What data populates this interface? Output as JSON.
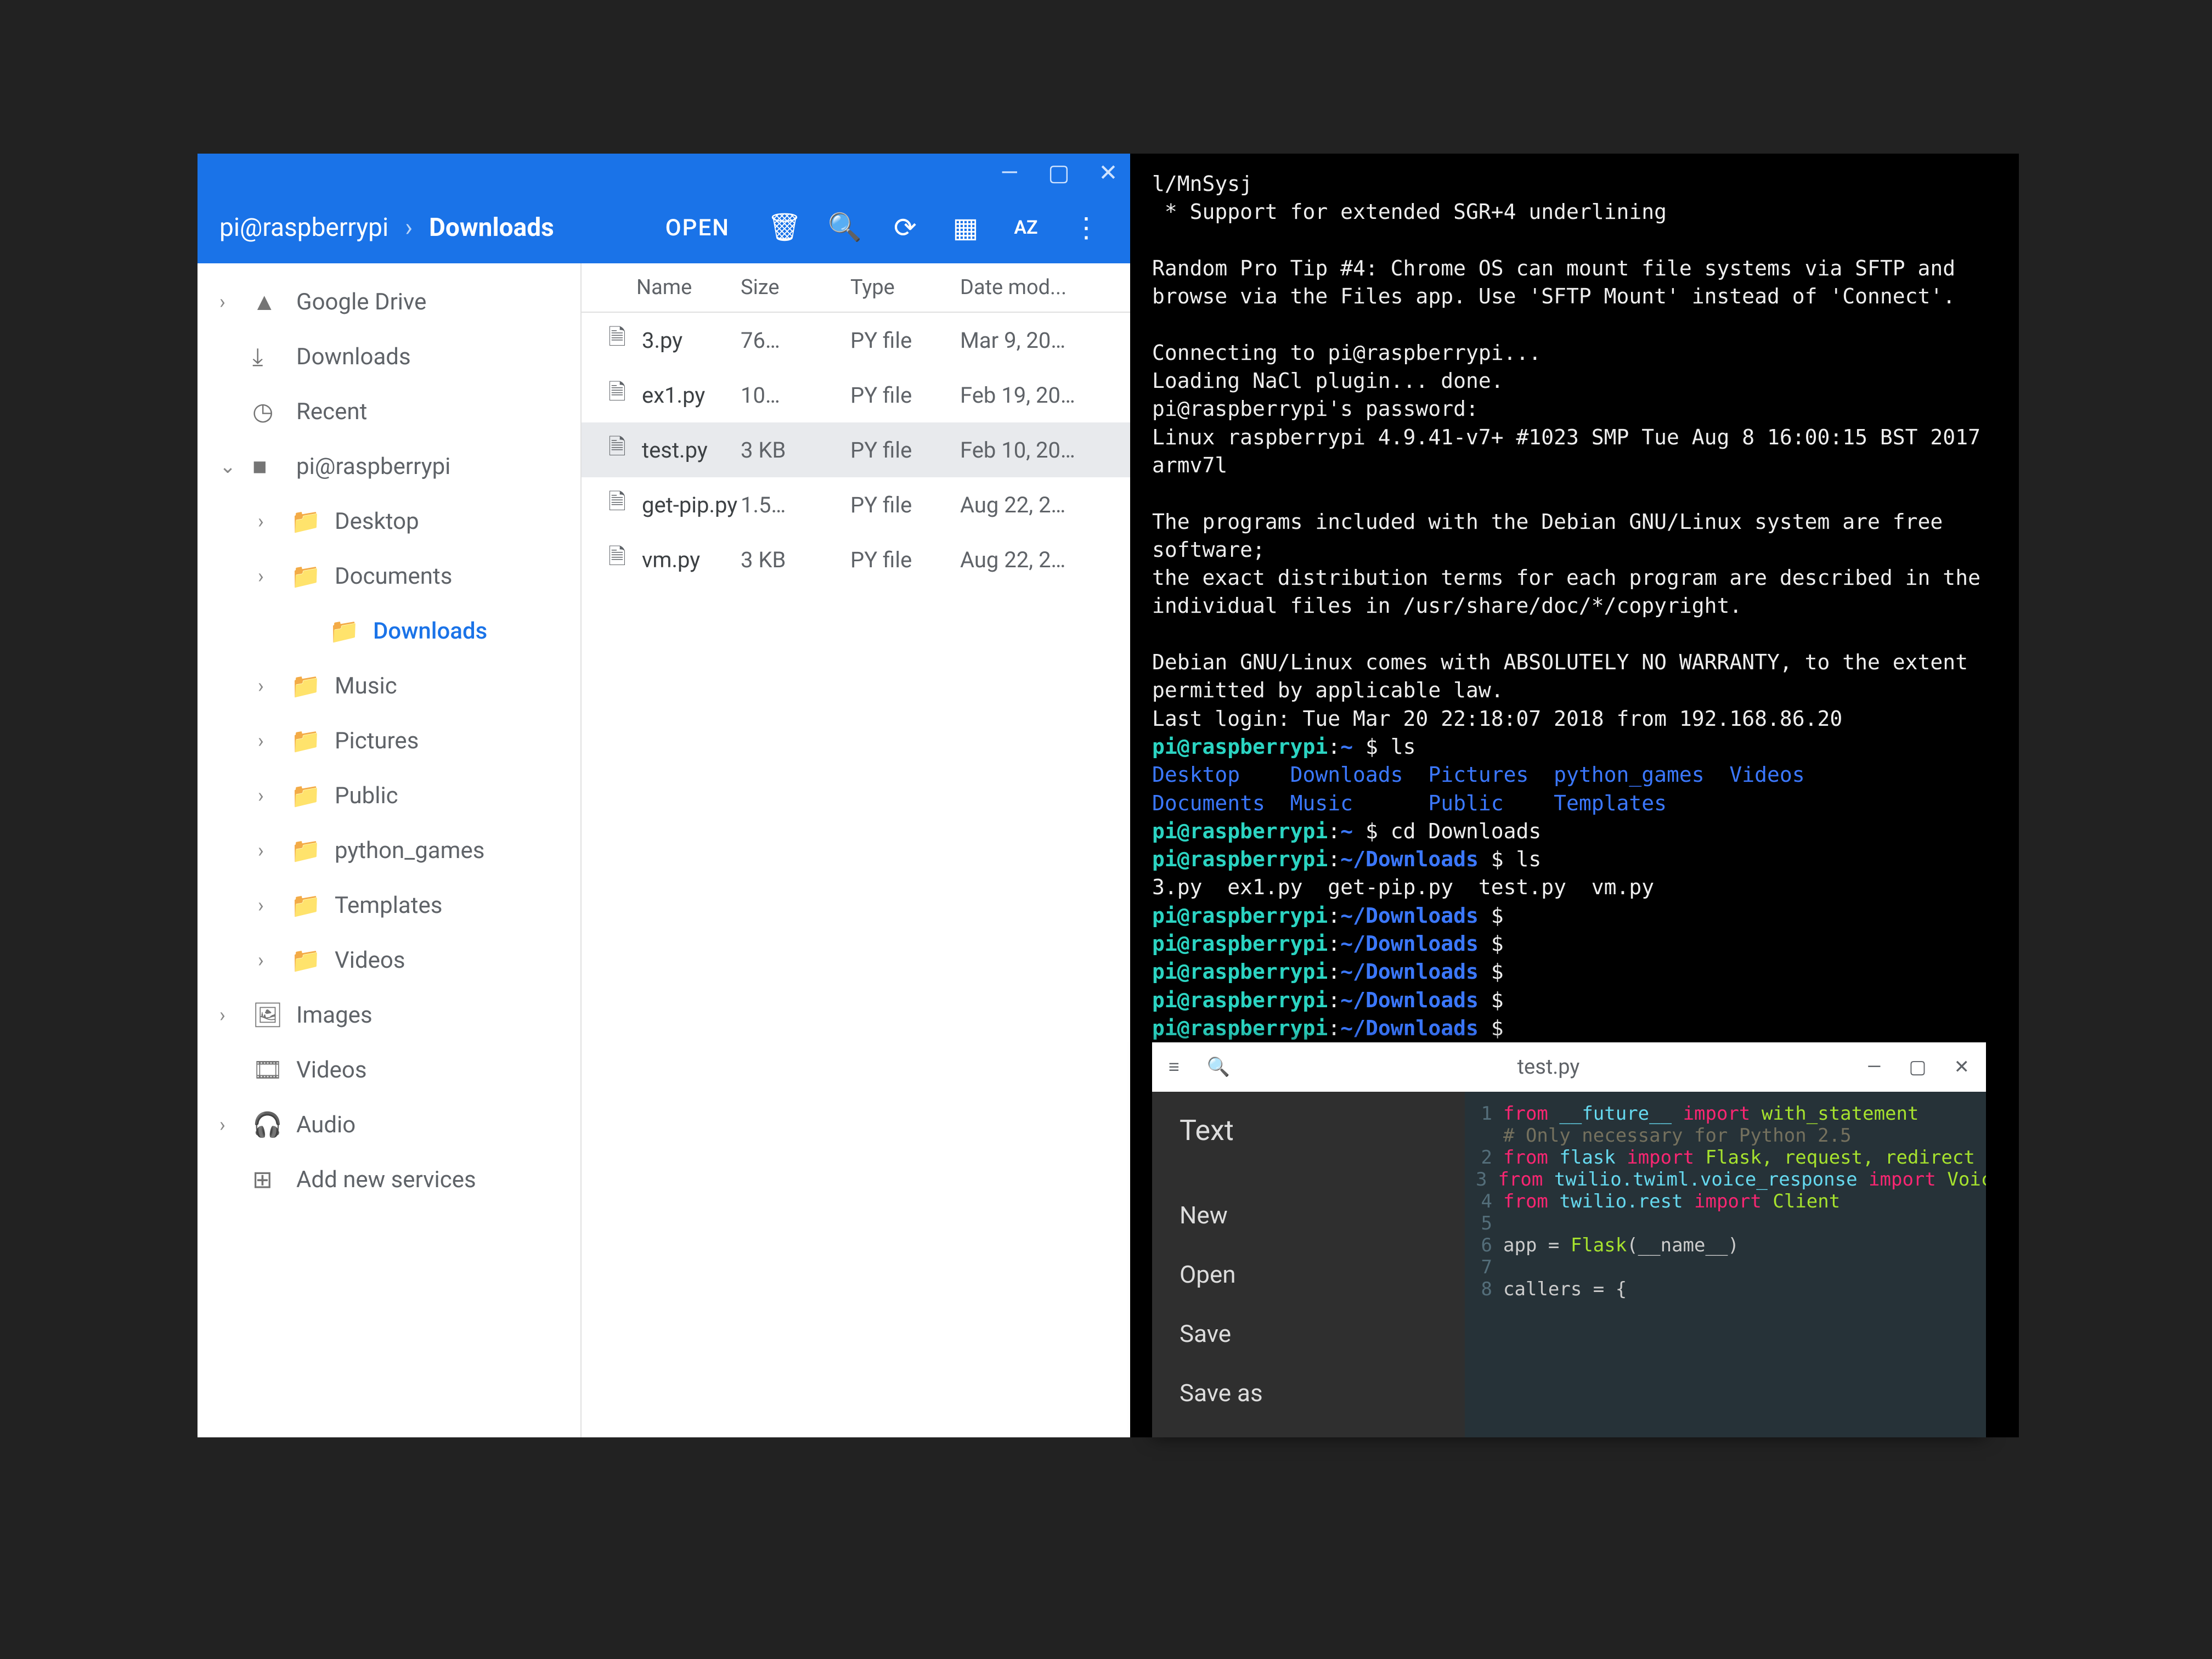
{
  "files": {
    "breadcrumb": [
      "pi@raspberrypi",
      "Downloads"
    ],
    "toolbar": {
      "open": "OPEN",
      "icons": [
        "delete",
        "search",
        "refresh",
        "view",
        "sort",
        "more"
      ]
    },
    "columns": {
      "name": "Name",
      "size": "Size",
      "type": "Type",
      "date": "Date mod..."
    },
    "sidebar": [
      {
        "depth": 0,
        "caret": ">",
        "icon": "▲",
        "label": "Google Drive"
      },
      {
        "depth": 0,
        "caret": "",
        "icon": "⤓",
        "label": "Downloads"
      },
      {
        "depth": 0,
        "caret": "",
        "icon": "◷",
        "label": "Recent"
      },
      {
        "depth": 0,
        "caret": "v",
        "icon": "■",
        "label": "pi@raspberrypi"
      },
      {
        "depth": 1,
        "caret": ">",
        "icon": "📁",
        "label": "Desktop"
      },
      {
        "depth": 1,
        "caret": ">",
        "icon": "📁",
        "label": "Documents"
      },
      {
        "depth": 2,
        "caret": "",
        "icon": "📁",
        "label": "Downloads",
        "active": true
      },
      {
        "depth": 1,
        "caret": ">",
        "icon": "📁",
        "label": "Music"
      },
      {
        "depth": 1,
        "caret": ">",
        "icon": "📁",
        "label": "Pictures"
      },
      {
        "depth": 1,
        "caret": ">",
        "icon": "📁",
        "label": "Public"
      },
      {
        "depth": 1,
        "caret": ">",
        "icon": "📁",
        "label": "python_games"
      },
      {
        "depth": 1,
        "caret": ">",
        "icon": "📁",
        "label": "Templates"
      },
      {
        "depth": 1,
        "caret": ">",
        "icon": "📁",
        "label": "Videos"
      },
      {
        "depth": 0,
        "caret": ">",
        "icon": "🖼",
        "label": "Images"
      },
      {
        "depth": 0,
        "caret": "",
        "icon": "🎞",
        "label": "Videos"
      },
      {
        "depth": 0,
        "caret": ">",
        "icon": "🎧",
        "label": "Audio"
      },
      {
        "depth": 0,
        "caret": "",
        "icon": "⊞",
        "label": "Add new services"
      }
    ],
    "rows": [
      {
        "name": "3.py",
        "size": "76…",
        "type": "PY file",
        "date": "Mar 9, 20…"
      },
      {
        "name": "ex1.py",
        "size": "10…",
        "type": "PY file",
        "date": "Feb 19, 20…"
      },
      {
        "name": "test.py",
        "size": "3 KB",
        "type": "PY file",
        "date": "Feb 10, 20…",
        "selected": true
      },
      {
        "name": "get-pip.py",
        "size": "1.5…",
        "type": "PY file",
        "date": "Aug 22, 2…"
      },
      {
        "name": "vm.py",
        "size": "3 KB",
        "type": "PY file",
        "date": "Aug 22, 2…"
      }
    ]
  },
  "terminal": {
    "lines": [
      {
        "t": "l/MnSysj"
      },
      {
        "t": " * Support for extended SGR+4 underlining"
      },
      {
        "t": ""
      },
      {
        "t": "Random Pro Tip #4: Chrome OS can mount file systems via SFTP and browse via the Files app. Use 'SFTP Mount' instead of 'Connect'."
      },
      {
        "t": ""
      },
      {
        "t": "Connecting to pi@raspberrypi..."
      },
      {
        "t": "Loading NaCl plugin... done."
      },
      {
        "t": "pi@raspberrypi's password:"
      },
      {
        "t": "Linux raspberrypi 4.9.41-v7+ #1023 SMP Tue Aug 8 16:00:15 BST 2017 armv7l"
      },
      {
        "t": ""
      },
      {
        "t": "The programs included with the Debian GNU/Linux system are free software;"
      },
      {
        "t": "the exact distribution terms for each program are described in the individual files in /usr/share/doc/*/copyright."
      },
      {
        "t": ""
      },
      {
        "t": "Debian GNU/Linux comes with ABSOLUTELY NO WARRANTY, to the extent permitted by applicable law."
      },
      {
        "t": "Last login: Tue Mar 20 22:18:07 2018 from 192.168.86.20"
      },
      {
        "prompt": "pi@raspberrypi",
        "path": "~",
        "cmd": "ls"
      },
      {
        "dirlist": "Desktop    Downloads  Pictures  python_games  Videos"
      },
      {
        "dirlist": "Documents  Music      Public    Templates"
      },
      {
        "prompt": "pi@raspberrypi",
        "path": "~",
        "cmd": "cd Downloads"
      },
      {
        "prompt": "pi@raspberrypi",
        "path": "~/Downloads",
        "cmd": "ls"
      },
      {
        "t": "3.py  ex1.py  get-pip.py  test.py  vm.py"
      },
      {
        "prompt": "pi@raspberrypi",
        "path": "~/Downloads",
        "cmd": ""
      },
      {
        "prompt": "pi@raspberrypi",
        "path": "~/Downloads",
        "cmd": ""
      },
      {
        "prompt": "pi@raspberrypi",
        "path": "~/Downloads",
        "cmd": ""
      },
      {
        "prompt": "pi@raspberrypi",
        "path": "~/Downloads",
        "cmd": ""
      },
      {
        "prompt": "pi@raspberrypi",
        "path": "~/Downloads",
        "cmd": ""
      }
    ]
  },
  "editor": {
    "title": "test.py",
    "menu": {
      "heading": "Text",
      "items": [
        "New",
        "Open",
        "Save",
        "Save as"
      ]
    },
    "code": [
      {
        "n": 1,
        "html": "<span class='kw'>from</span> <span class='mod'>__future__</span> <span class='kw'>import</span> <span class='fn'>with_statement</span>"
      },
      {
        "n": "",
        "html": "<span class='com'># Only necessary for Python 2.5</span>"
      },
      {
        "n": 2,
        "html": "<span class='kw'>from</span> <span class='mod'>flask</span> <span class='kw'>import</span> <span class='fn'>Flask, request, redirect</span>"
      },
      {
        "n": 3,
        "html": "<span class='kw'>from</span> <span class='mod'>twilio.twiml.voice_response</span> <span class='kw'>import</span> <span class='fn'>VoiceResponse, Gather</span>"
      },
      {
        "n": 4,
        "html": "<span class='kw'>from</span> <span class='mod'>twilio.rest</span> <span class='kw'>import</span> <span class='fn'>Client</span>"
      },
      {
        "n": 5,
        "html": ""
      },
      {
        "n": 6,
        "html": "app = <span class='fn'>Flask</span>(__name__)"
      },
      {
        "n": 7,
        "html": ""
      },
      {
        "n": 8,
        "html": "callers = {"
      }
    ]
  }
}
